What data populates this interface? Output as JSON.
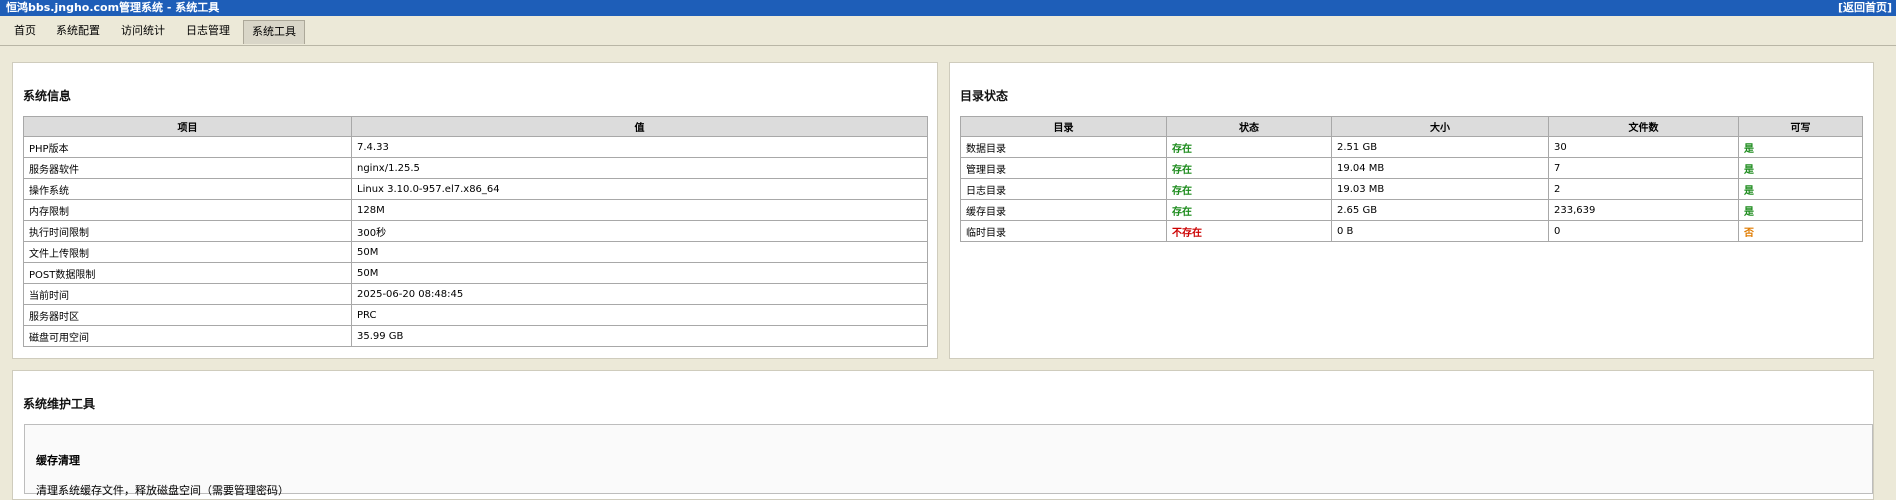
{
  "titlebar": {
    "title": "恒鸿bbs.jngho.com管理系统 - 系统工具",
    "back_link": "[返回首页]"
  },
  "nav": {
    "tabs": [
      {
        "label": "首页"
      },
      {
        "label": "系统配置"
      },
      {
        "label": "访问统计"
      },
      {
        "label": "日志管理"
      },
      {
        "label": "系统工具",
        "active": true
      }
    ]
  },
  "system_info": {
    "title": "系统信息",
    "headers": [
      "项目",
      "值"
    ],
    "rows": [
      [
        "PHP版本",
        "7.4.33"
      ],
      [
        "服务器软件",
        "nginx/1.25.5"
      ],
      [
        "操作系统",
        "Linux 3.10.0-957.el7.x86_64"
      ],
      [
        "内存限制",
        "128M"
      ],
      [
        "执行时间限制",
        "300秒"
      ],
      [
        "文件上传限制",
        "50M"
      ],
      [
        "POST数据限制",
        "50M"
      ],
      [
        "当前时间",
        "2025-06-20 08:48:45"
      ],
      [
        "服务器时区",
        "PRC"
      ],
      [
        "磁盘可用空间",
        "35.99 GB"
      ]
    ]
  },
  "dir_status": {
    "title": "目录状态",
    "headers": [
      "目录",
      "状态",
      "大小",
      "文件数",
      "可写"
    ],
    "rows": [
      [
        "数据目录",
        "存在",
        "2.51 GB",
        "30",
        "是"
      ],
      [
        "管理目录",
        "存在",
        "19.04 MB",
        "7",
        "是"
      ],
      [
        "日志目录",
        "存在",
        "19.03 MB",
        "2",
        "是"
      ],
      [
        "缓存目录",
        "存在",
        "2.65 GB",
        "233,639",
        "是"
      ],
      [
        "临时目录",
        "不存在",
        "0 B",
        "0",
        "否"
      ]
    ]
  },
  "maintenance": {
    "title": "系统维护工具",
    "cache_title": "缓存清理",
    "cache_desc": "清理系统缓存文件，释放磁盘空间（需要管理密码）"
  },
  "colors": {
    "titlebar": "#1e5eb8",
    "ok": "#1a8a1a",
    "missing": "#cc0000",
    "not_writable": "#e07b00"
  }
}
